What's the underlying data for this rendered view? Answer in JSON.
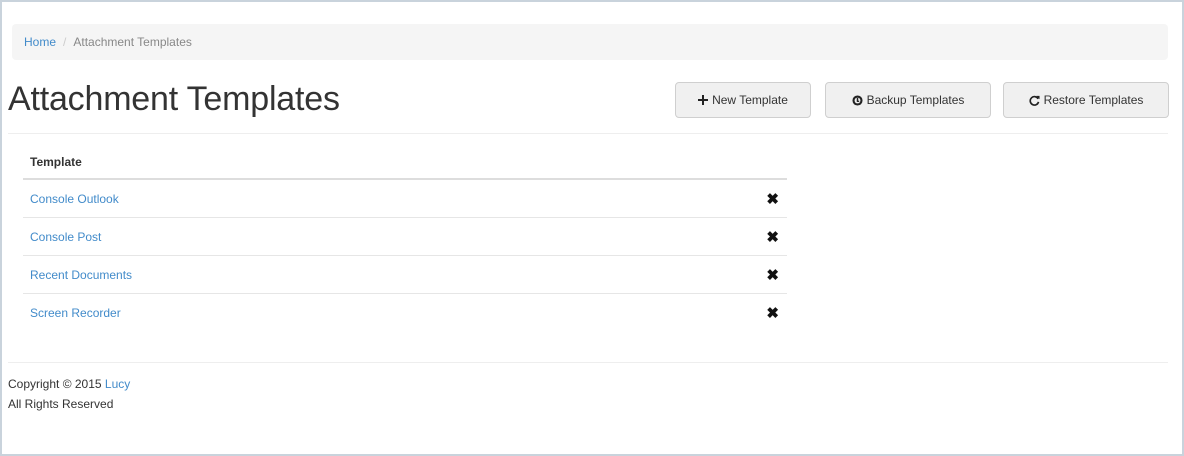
{
  "breadcrumb": {
    "home": "Home",
    "separator": "/",
    "current": "Attachment Templates"
  },
  "page": {
    "title": "Attachment Templates"
  },
  "toolbar": {
    "new_label": "New Template",
    "new_icon": "plus-icon",
    "backup_label": "Backup Templates",
    "backup_icon": "backup-icon",
    "restore_label": "Restore Templates",
    "restore_icon": "refresh-icon"
  },
  "table": {
    "header": "Template",
    "rows": [
      {
        "name": "Console Outlook"
      },
      {
        "name": "Console Post"
      },
      {
        "name": "Recent Documents"
      },
      {
        "name": "Screen Recorder"
      }
    ],
    "delete_glyph": "✖"
  },
  "footer": {
    "copyright": "Copyright © 2015",
    "brand": "Lucy",
    "rights": "All Rights Reserved"
  },
  "colors": {
    "link": "#428bca",
    "breadcrumb_bg": "#f5f5f5",
    "button_bg": "#f0f0f0"
  }
}
